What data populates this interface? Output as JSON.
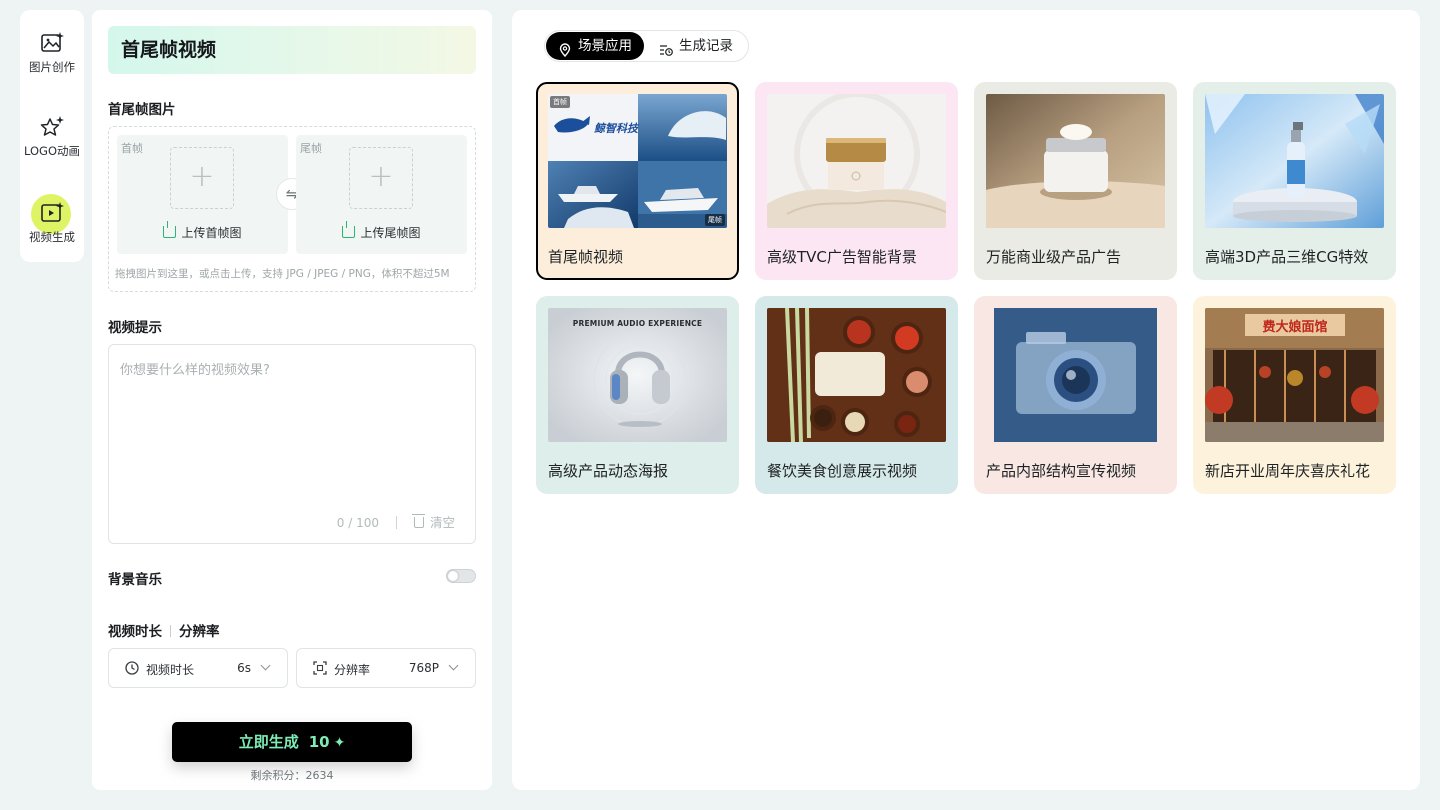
{
  "sidebar": {
    "items": [
      {
        "label": "图片创作",
        "icon": "image-sparkle-icon"
      },
      {
        "label": "LOGO动画",
        "icon": "star-sparkle-icon"
      },
      {
        "label": "视频生成",
        "icon": "video-sparkle-icon",
        "active": true
      }
    ]
  },
  "form": {
    "title": "首尾帧视频",
    "images_label": "首尾帧图片",
    "first_frame": {
      "tag": "首帧",
      "upload_label": "上传首帧图"
    },
    "last_frame": {
      "tag": "尾帧",
      "upload_label": "上传尾帧图"
    },
    "upload_hint": "拖拽图片到这里，或点击上传，支持 JPG / JPEG / PNG，体积不超过5M",
    "prompt_label": "视频提示",
    "prompt_placeholder": "你想要什么样的视频效果?",
    "prompt_counter": "0 / 100",
    "clear_label": "清空",
    "music_label": "背景音乐",
    "music_enabled": false,
    "duration_heading": "视频时长",
    "resolution_heading": "分辨率",
    "duration_select": {
      "label": "视频时长",
      "value": "6s"
    },
    "resolution_select": {
      "label": "分辨率",
      "value": "768P"
    },
    "generate_label": "立即生成",
    "generate_cost": "10",
    "points_text": "剩余积分：2634"
  },
  "main": {
    "tabs": [
      {
        "label": "场景应用",
        "icon": "location-pin-icon",
        "active": true
      },
      {
        "label": "生成记录",
        "icon": "history-list-icon"
      }
    ],
    "cards": [
      {
        "title": "首尾帧视频",
        "bg": "#fdeedb",
        "selected": true,
        "badge_first": "首帧",
        "badge_last": "尾帧",
        "brand": "鲸智科技"
      },
      {
        "title": "高级TVC广告智能背景",
        "bg": "#fce6f3"
      },
      {
        "title": "万能商业级产品广告",
        "bg": "#e9ebe4"
      },
      {
        "title": "高端3D产品三维CG特效",
        "bg": "#e5efe9"
      },
      {
        "title": "高级产品动态海报",
        "bg": "#deeeea",
        "poster_caption": "PREMIUM AUDIO EXPERIENCE"
      },
      {
        "title": "餐饮美食创意展示视频",
        "bg": "#d6e9ea"
      },
      {
        "title": "产品内部结构宣传视频",
        "bg": "#f8e7e3"
      },
      {
        "title": "新店开业周年庆喜庆礼花",
        "bg": "#fdf3dc",
        "shop_sign": "费大娘面馆"
      }
    ]
  },
  "colors": {
    "accent": "#7dedb5",
    "active_rail": "#d8f24a",
    "background": "#eef4f3"
  }
}
